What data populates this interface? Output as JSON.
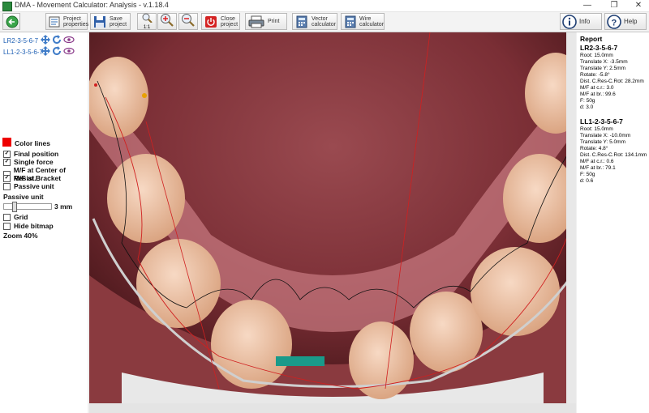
{
  "window": {
    "title": "DMA - Movement Calculator: Analysis - v.1.18.4"
  },
  "toolbar": {
    "project_properties": "Project\nproperties",
    "save_project": "Save\nproject",
    "zoom_1_1": "1:1",
    "close_project": "Close\nproject",
    "print": "Print",
    "vector_calculator": "Vector\ncalculator",
    "wire_calculator": "Wire\ncalculator",
    "info": "Info",
    "help": "Help"
  },
  "left_panel": {
    "movements": [
      {
        "label": "LR2-3-5-6-7"
      },
      {
        "label": "LL1-2-3-5-6-7"
      }
    ],
    "color_lines": "Color lines",
    "options": [
      {
        "label": "Final position",
        "checked": true
      },
      {
        "label": "Single force",
        "checked": true
      },
      {
        "label": "M/F at Center of Resist.",
        "checked": false
      },
      {
        "label": "M/F at Bracket",
        "checked": true
      },
      {
        "label": "Passive unit",
        "checked": false
      }
    ],
    "passive_unit_label": "Passive unit",
    "passive_value": "3 mm",
    "grid": {
      "label": "Grid",
      "checked": false
    },
    "hide_bitmap": {
      "label": "Hide bitmap",
      "checked": false
    },
    "zoom": "Zoom 40%"
  },
  "report": {
    "title": "Report",
    "sections": [
      {
        "name": "LR2-3-5-6-7",
        "lines": [
          "Root: 15.0mm",
          "Translate X: -3.5mm",
          "Translate Y: 2.5mm",
          "Rotate: -5.8°",
          "Dist. C.Res-C.Rot: 28.2mm",
          "M/F at c.r.: 3.0",
          "M/F at br.: 99.6",
          "F: 50g",
          "d: 3.0"
        ]
      },
      {
        "name": "LL1-2-3-5-6-7",
        "lines": [
          "Root: 15.0mm",
          "Translate X: -10.0mm",
          "Translate Y: 5.0mm",
          "Rotate: 4.8°",
          "Dist. C.Res-C.Rot: 134.1mm",
          "M/F at c.r.: 0.6",
          "M/F at br.: 79.1",
          "F: 50g",
          "d: 0.6"
        ]
      }
    ]
  },
  "icons": [
    "back-arrow-icon",
    "project-properties-icon",
    "save-icon",
    "zoom-1-1-icon",
    "zoom-in-icon",
    "zoom-out-icon",
    "close-project-icon",
    "print-icon",
    "vector-calculator-icon",
    "wire-calculator-icon",
    "info-icon",
    "help-icon",
    "move-icon",
    "rotate-icon",
    "eye-icon"
  ]
}
